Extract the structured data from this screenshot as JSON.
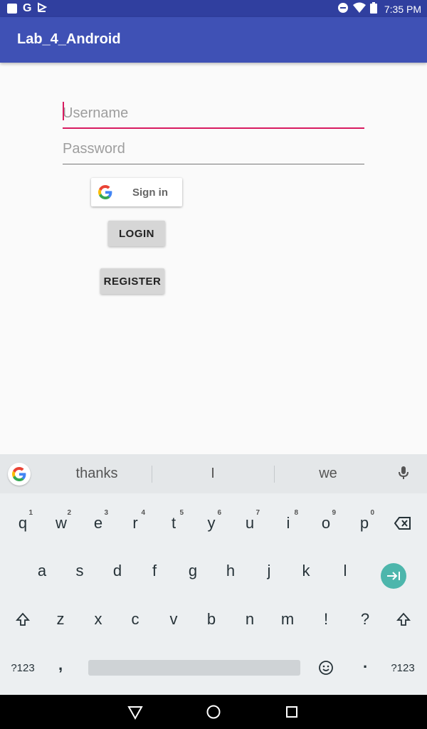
{
  "status_bar": {
    "time": "7:35 PM",
    "notif_g": "G"
  },
  "app_bar": {
    "title": "Lab_4_Android"
  },
  "form": {
    "username_placeholder": "Username",
    "username_value": "",
    "password_placeholder": "Password",
    "password_value": ""
  },
  "google_signin": {
    "label": "Sign in"
  },
  "buttons": {
    "login": "LOGIN",
    "register": "REGISTER"
  },
  "keyboard": {
    "suggestions": [
      "thanks",
      "I",
      "we"
    ],
    "row1": [
      {
        "k": "q",
        "h": "1"
      },
      {
        "k": "w",
        "h": "2"
      },
      {
        "k": "e",
        "h": "3"
      },
      {
        "k": "r",
        "h": "4"
      },
      {
        "k": "t",
        "h": "5"
      },
      {
        "k": "y",
        "h": "6"
      },
      {
        "k": "u",
        "h": "7"
      },
      {
        "k": "i",
        "h": "8"
      },
      {
        "k": "o",
        "h": "9"
      },
      {
        "k": "p",
        "h": "0"
      }
    ],
    "row2": [
      "a",
      "s",
      "d",
      "f",
      "g",
      "h",
      "j",
      "k",
      "l"
    ],
    "row3": [
      "z",
      "x",
      "c",
      "v",
      "b",
      "n",
      "m",
      "!",
      "?"
    ],
    "symbols_label": "?123",
    "comma": ",",
    "period": "."
  },
  "colors": {
    "primary": "#3f51b5",
    "primary_dark": "#303f9f",
    "accent": "#d81b60",
    "enter": "#4db6ac"
  },
  "icons": {
    "status_left": [
      "square-notification-icon",
      "google-g-icon",
      "download-icon"
    ],
    "status_right": [
      "do-not-disturb-icon",
      "wifi-icon",
      "battery-icon"
    ],
    "nav": [
      "back-icon",
      "home-icon",
      "recents-icon"
    ]
  }
}
